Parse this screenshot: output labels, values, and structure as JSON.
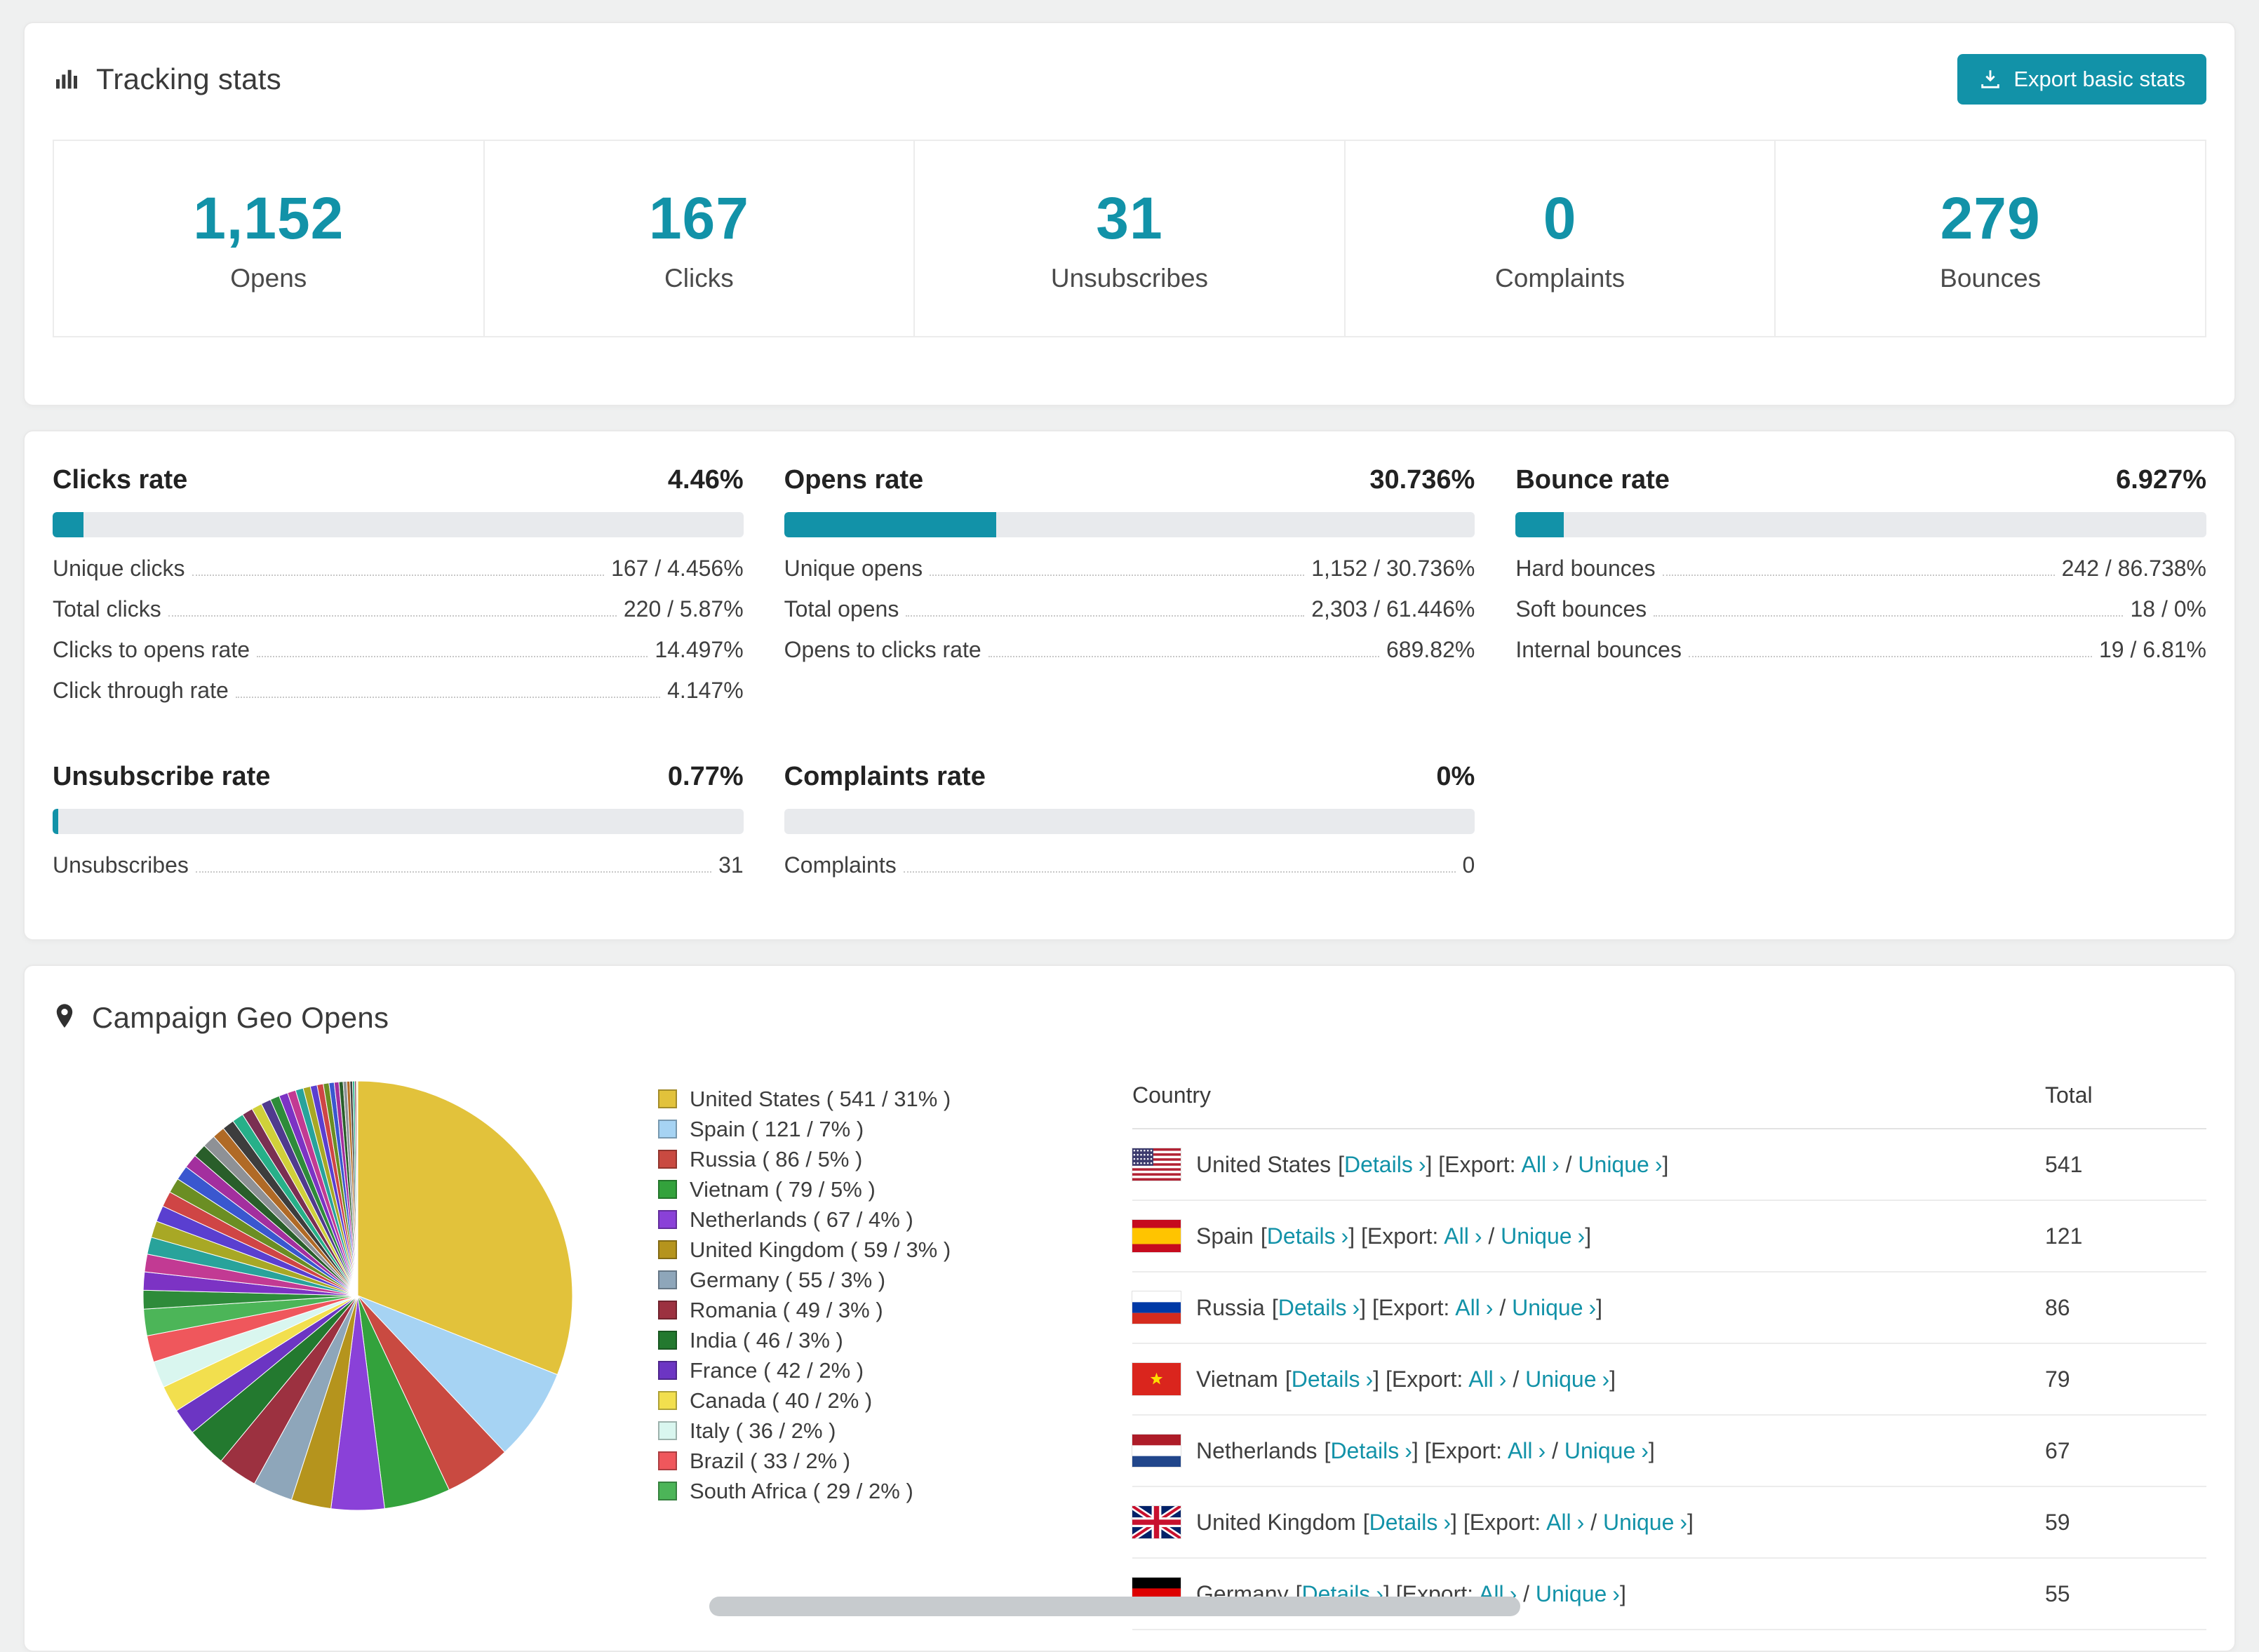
{
  "colors": {
    "accent": "#1292a8",
    "bar_track": "#e8eaed"
  },
  "tracking": {
    "title": "Tracking stats",
    "export_label": "Export basic stats",
    "stats": [
      {
        "value": "1,152",
        "label": "Opens"
      },
      {
        "value": "167",
        "label": "Clicks"
      },
      {
        "value": "31",
        "label": "Unsubscribes"
      },
      {
        "value": "0",
        "label": "Complaints"
      },
      {
        "value": "279",
        "label": "Bounces"
      }
    ]
  },
  "rates": [
    {
      "title": "Clicks rate",
      "pct_label": "4.46%",
      "pct": 4.46,
      "rows": [
        {
          "label": "Unique clicks",
          "value": "167 / 4.456%"
        },
        {
          "label": "Total clicks",
          "value": "220 / 5.87%"
        },
        {
          "label": "Clicks to opens rate",
          "value": "14.497%"
        },
        {
          "label": "Click through rate",
          "value": "4.147%"
        }
      ]
    },
    {
      "title": "Opens rate",
      "pct_label": "30.736%",
      "pct": 30.736,
      "rows": [
        {
          "label": "Unique opens",
          "value": "1,152 / 30.736%"
        },
        {
          "label": "Total opens",
          "value": "2,303 / 61.446%"
        },
        {
          "label": "Opens to clicks rate",
          "value": "689.82%"
        }
      ]
    },
    {
      "title": "Bounce rate",
      "pct_label": "6.927%",
      "pct": 6.927,
      "rows": [
        {
          "label": "Hard bounces",
          "value": "242 / 86.738%"
        },
        {
          "label": "Soft bounces",
          "value": "18 / 0%"
        },
        {
          "label": "Internal bounces",
          "value": "19 / 6.81%"
        }
      ]
    },
    {
      "title": "Unsubscribe rate",
      "pct_label": "0.77%",
      "pct": 0.77,
      "rows": [
        {
          "label": "Unsubscribes",
          "value": "31"
        }
      ]
    },
    {
      "title": "Complaints rate",
      "pct_label": "0%",
      "pct": 0,
      "rows": [
        {
          "label": "Complaints",
          "value": "0"
        }
      ]
    }
  ],
  "geo": {
    "title": "Campaign Geo Opens",
    "table": {
      "country_header": "Country",
      "total_header": "Total",
      "details_label": "Details",
      "export_label": "Export:",
      "all_label": "All",
      "unique_label": "Unique",
      "chevron": "›",
      "bracket_open": "[",
      "bracket_close": "]",
      "rows": [
        {
          "country": "United States",
          "total": "541",
          "flag": "us"
        },
        {
          "country": "Spain",
          "total": "121",
          "flag": "es"
        },
        {
          "country": "Russia",
          "total": "86",
          "flag": "ru"
        },
        {
          "country": "Vietnam",
          "total": "79",
          "flag": "vn"
        },
        {
          "country": "Netherlands",
          "total": "67",
          "flag": "nl"
        },
        {
          "country": "United Kingdom",
          "total": "59",
          "flag": "gb"
        },
        {
          "country": "Germany",
          "total": "55",
          "flag": "de"
        }
      ]
    }
  },
  "chart_data": {
    "type": "pie",
    "title": "Campaign Geo Opens",
    "legend_position": "right",
    "unit": "opens",
    "slices": [
      {
        "label": "United States",
        "count": 541,
        "pct": 31,
        "color": "#e2c23b"
      },
      {
        "label": "Spain",
        "count": 121,
        "pct": 7,
        "color": "#a6d3f3"
      },
      {
        "label": "Russia",
        "count": 86,
        "pct": 5,
        "color": "#c94a41"
      },
      {
        "label": "Vietnam",
        "count": 79,
        "pct": 5,
        "color": "#33a23c"
      },
      {
        "label": "Netherlands",
        "count": 67,
        "pct": 4,
        "color": "#8a41d8"
      },
      {
        "label": "United Kingdom",
        "count": 59,
        "pct": 3,
        "color": "#b5941d"
      },
      {
        "label": "Germany",
        "count": 55,
        "pct": 3,
        "color": "#8ea6ba"
      },
      {
        "label": "Romania",
        "count": 49,
        "pct": 3,
        "color": "#9c3140"
      },
      {
        "label": "India",
        "count": 46,
        "pct": 3,
        "color": "#23792f"
      },
      {
        "label": "France",
        "count": 42,
        "pct": 2,
        "color": "#6c35c3"
      },
      {
        "label": "Canada",
        "count": 40,
        "pct": 2,
        "color": "#f2df4e"
      },
      {
        "label": "Italy",
        "count": 36,
        "pct": 2,
        "color": "#d9f6ef"
      },
      {
        "label": "Brazil",
        "count": 33,
        "pct": 2,
        "color": "#ef575c"
      },
      {
        "label": "South Africa",
        "count": 29,
        "pct": 2,
        "color": "#4cb558"
      }
    ],
    "others_pct": 26,
    "others_palette": [
      "#2e8b3a",
      "#7c33c4",
      "#c23a93",
      "#28a39b",
      "#a8a825",
      "#5a3fd0",
      "#cf4545",
      "#6b8e23",
      "#3a57cf",
      "#a32f9e",
      "#295e2a",
      "#8e9196",
      "#b06a26",
      "#3d3d3d",
      "#27b089",
      "#7a2f52",
      "#d0d03a",
      "#503a8e"
    ]
  }
}
